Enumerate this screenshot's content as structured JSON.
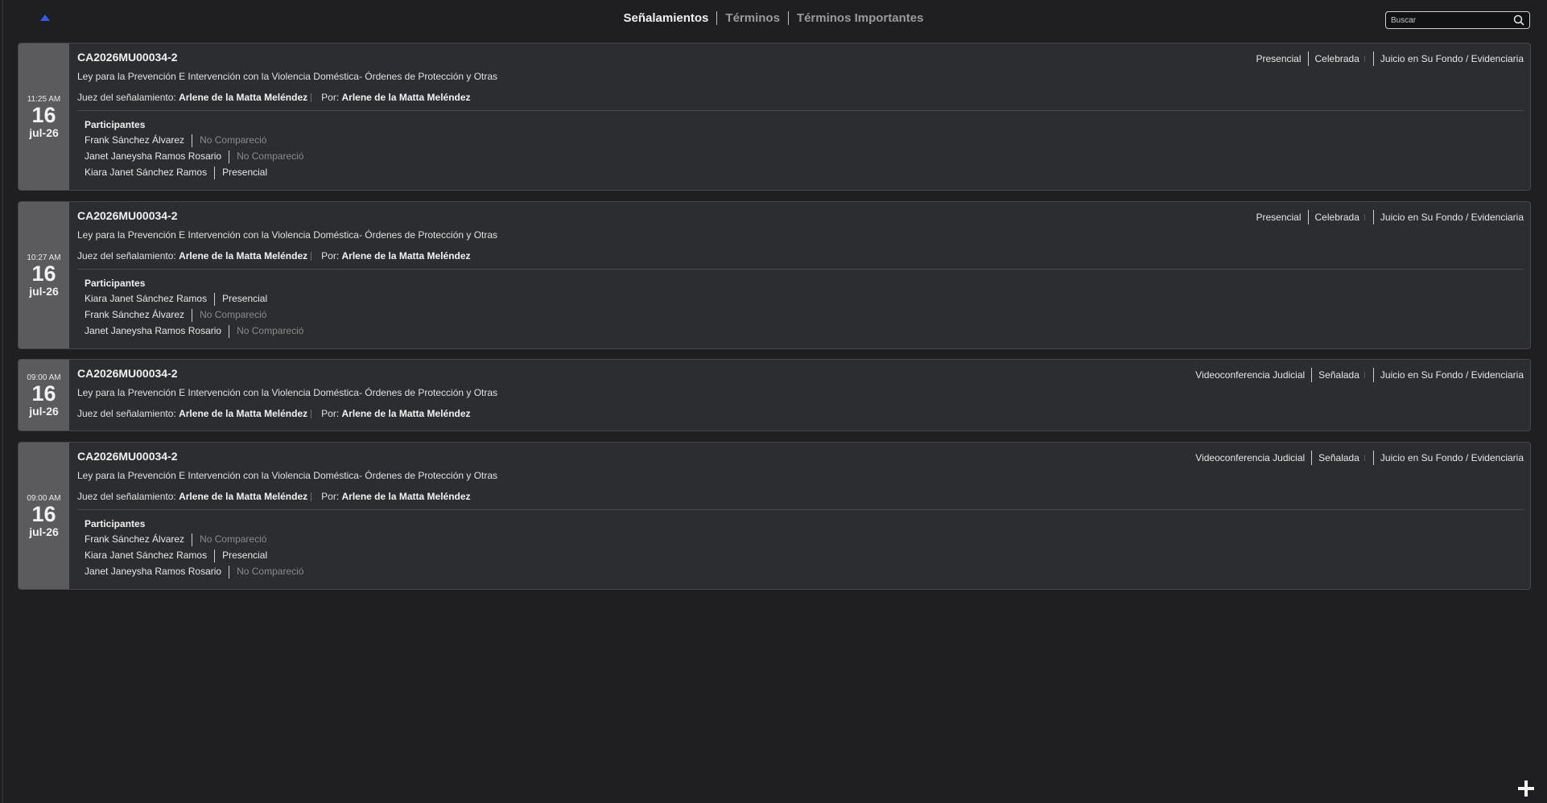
{
  "tabs": [
    "Señalamientos",
    "Términos",
    "Términos Importantes"
  ],
  "search": {
    "placeholder": "Buscar"
  },
  "judge_label": "Juez del señalamiento:",
  "by_label": "Por:",
  "participants_label": "Participantes",
  "cards": [
    {
      "time": "11:25 AM",
      "day": "16",
      "month": "jul-26",
      "case_number": "CA2026MU00034-2",
      "description": "Ley para la Prevención E Intervención con la Violencia Doméstica- Órdenes de Protección y Otras",
      "judge": "Arlene de la Matta Meléndez",
      "by": "Arlene de la Matta Meléndez",
      "modality": "Presencial",
      "status": "Celebrada",
      "hearing_type": "Juicio en Su Fondo / Evidenciaria",
      "participants": [
        {
          "name": "Frank Sánchez Álvarez",
          "status": "No Compareció"
        },
        {
          "name": "Janet Janeysha Ramos Rosario",
          "status": "No Compareció"
        },
        {
          "name": "Kiara Janet Sánchez Ramos",
          "status": "Presencial"
        }
      ]
    },
    {
      "time": "10:27 AM",
      "day": "16",
      "month": "jul-26",
      "case_number": "CA2026MU00034-2",
      "description": "Ley para la Prevención E Intervención con la Violencia Doméstica- Órdenes de Protección y Otras",
      "judge": "Arlene de la Matta Meléndez",
      "by": "Arlene de la Matta Meléndez",
      "modality": "Presencial",
      "status": "Celebrada",
      "hearing_type": "Juicio en Su Fondo / Evidenciaria",
      "participants": [
        {
          "name": "Kiara Janet Sánchez Ramos",
          "status": "Presencial"
        },
        {
          "name": "Frank Sánchez Álvarez",
          "status": "No Compareció"
        },
        {
          "name": "Janet Janeysha Ramos Rosario",
          "status": "No Compareció"
        }
      ]
    },
    {
      "time": "09:00 AM",
      "day": "16",
      "month": "jul-26",
      "case_number": "CA2026MU00034-2",
      "description": "Ley para la Prevención E Intervención con la Violencia Doméstica- Órdenes de Protección y Otras",
      "judge": "Arlene de la Matta Meléndez",
      "by": "Arlene de la Matta Meléndez",
      "modality": "Videoconferencia Judicial",
      "status": "Señalada",
      "hearing_type": "Juicio en Su Fondo / Evidenciaria",
      "participants": []
    },
    {
      "time": "09:00 AM",
      "day": "16",
      "month": "jul-26",
      "case_number": "CA2026MU00034-2",
      "description": "Ley para la Prevención E Intervención con la Violencia Doméstica- Órdenes de Protección y Otras",
      "judge": "Arlene de la Matta Meléndez",
      "by": "Arlene de la Matta Meléndez",
      "modality": "Videoconferencia Judicial",
      "status": "Señalada",
      "hearing_type": "Juicio en Su Fondo / Evidenciaria",
      "participants": [
        {
          "name": "Frank Sánchez Álvarez",
          "status": "No Compareció"
        },
        {
          "name": "Kiara Janet Sánchez Ramos",
          "status": "Presencial"
        },
        {
          "name": "Janet Janeysha Ramos Rosario",
          "status": "No Compareció"
        }
      ]
    }
  ]
}
